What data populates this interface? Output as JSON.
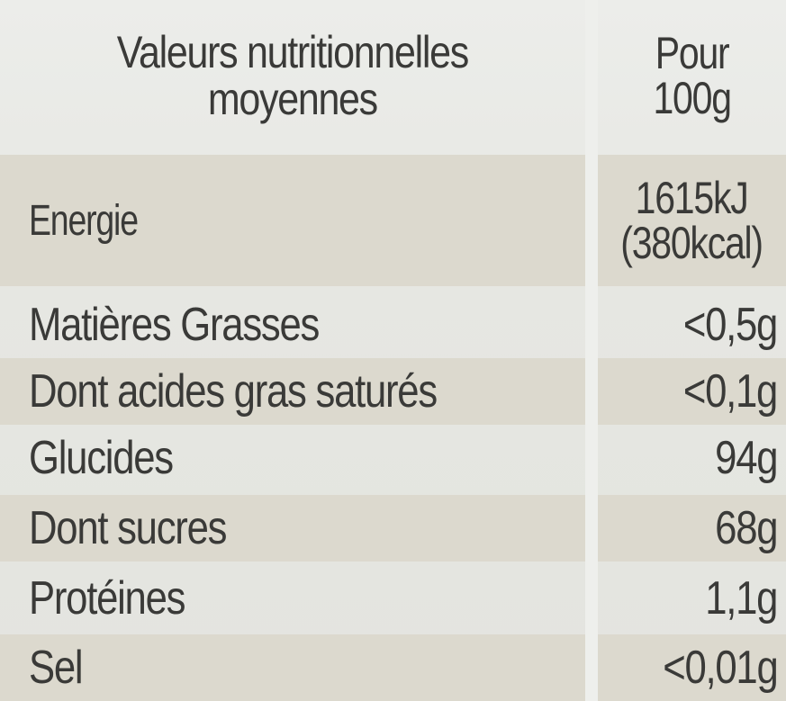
{
  "header": {
    "title_line1": "Valeurs nutritionnelles",
    "title_line2": "moyennes",
    "per_line1": "Pour",
    "per_line2": "100g"
  },
  "energy": {
    "label": "Energie",
    "kj": "1615kJ",
    "kcal": "(380kcal)"
  },
  "rows": [
    {
      "label": "Matières Grasses",
      "value": "<0,5g"
    },
    {
      "label": "Dont acides gras saturés",
      "value": "<0,1g"
    },
    {
      "label": "Glucides",
      "value": "94g"
    },
    {
      "label": "Dont sucres",
      "value": "68g"
    },
    {
      "label": "Protéines",
      "value": "1,1g"
    },
    {
      "label": "Sel",
      "value": "<0,01g"
    }
  ]
}
